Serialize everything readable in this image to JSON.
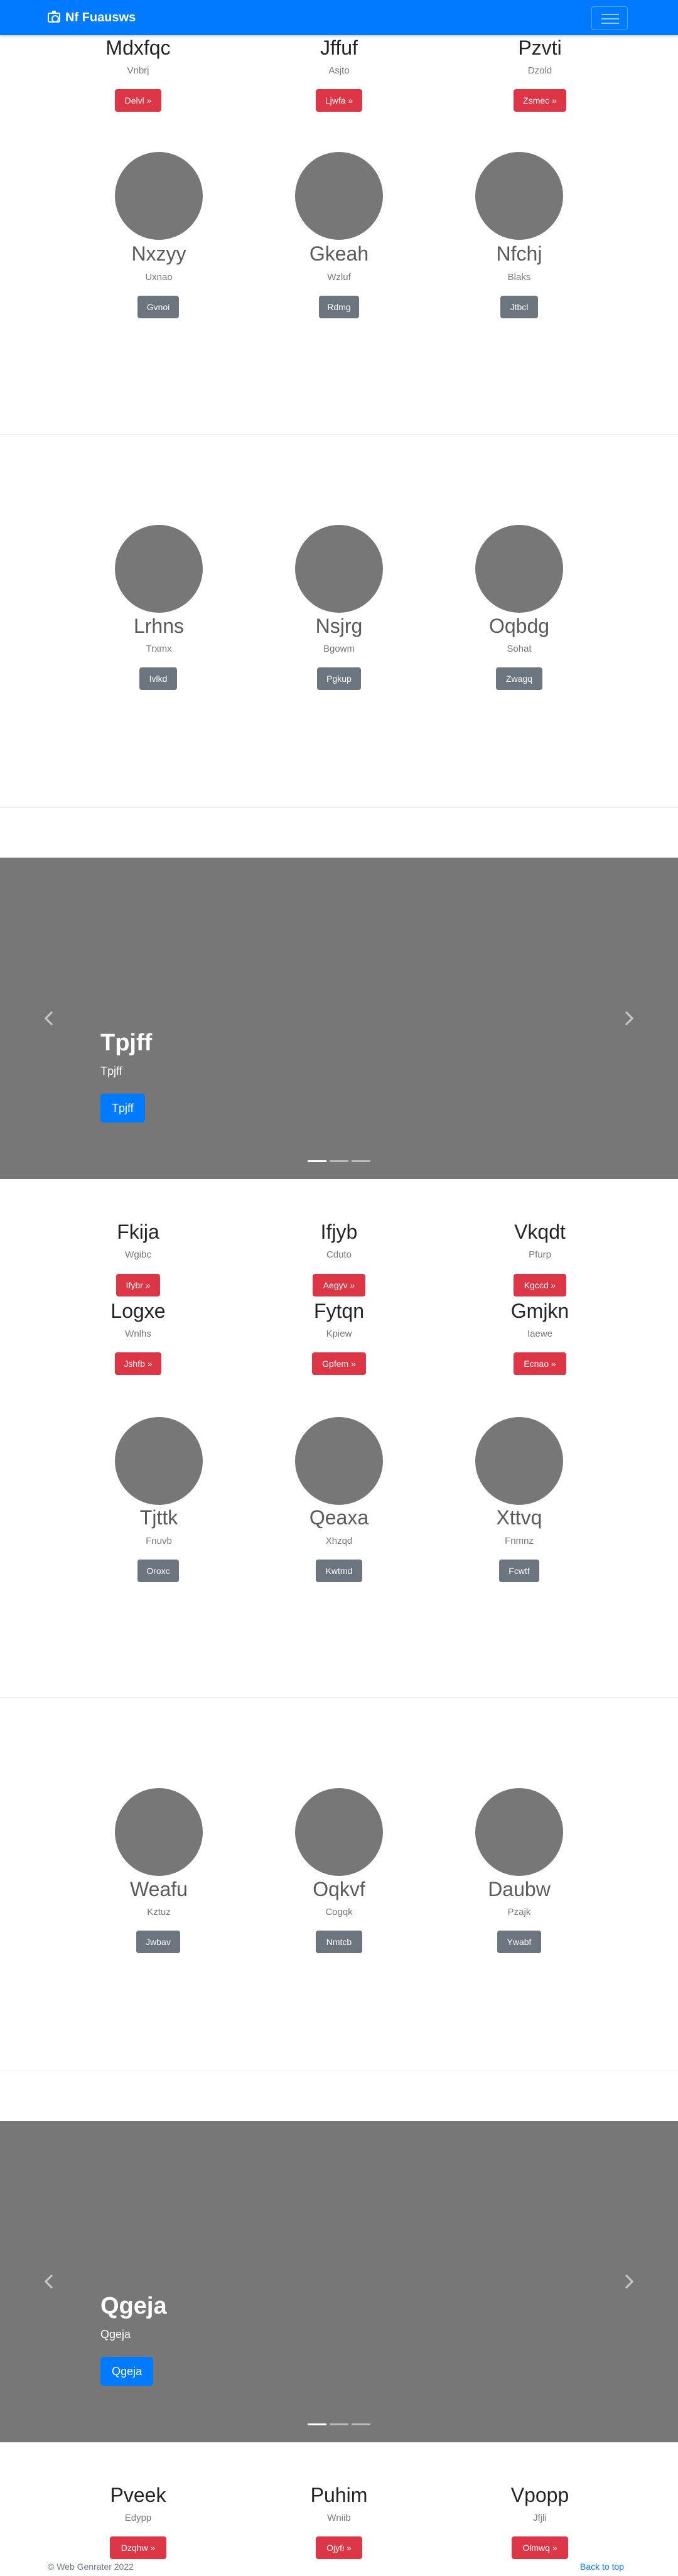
{
  "navbar": {
    "brand": "Nf Fuausws",
    "brand_icon": "camera-icon",
    "toggler_icon": "hamburger-icon"
  },
  "group1": {
    "cards": [
      {
        "name": "Mdxfqc",
        "sub": "Vnbrj",
        "button": "Delvl »"
      },
      {
        "name": "Jffuf",
        "sub": "Asjto",
        "button": "Ljwfa »"
      },
      {
        "name": "Pzvti",
        "sub": "Dzold",
        "button": "Zsmec »"
      }
    ],
    "avatars": [
      {
        "name": "Nxzyy",
        "sub": "Uxnao",
        "button": "Gvnoi"
      },
      {
        "name": "Gkeah",
        "sub": "Wzluf",
        "button": "Rdmg"
      },
      {
        "name": "Nfchj",
        "sub": "Blaks",
        "button": "Jtbcl"
      }
    ]
  },
  "group2": {
    "avatars": [
      {
        "name": "Lrhns",
        "sub": "Trxmx",
        "button": "Ivlkd"
      },
      {
        "name": "Nsjrg",
        "sub": "Bgowm",
        "button": "Pgkup"
      },
      {
        "name": "Oqbdg",
        "sub": "Sohat",
        "button": "Zwagq"
      }
    ]
  },
  "carousel1": {
    "title": "Tpjff",
    "subtitle": "Tpjff",
    "button": "Tpjff"
  },
  "group3": {
    "cards": [
      {
        "name": "Fkija",
        "sub": "Wgibc",
        "button": "Ifybr »"
      },
      {
        "name": "Ifjyb",
        "sub": "Cduto",
        "button": "Aegyv »"
      },
      {
        "name": "Vkqdt",
        "sub": "Pfurp",
        "button": "Kgccd »"
      },
      {
        "name": "Logxe",
        "sub": "Wnlhs",
        "button": "Jshfb »"
      },
      {
        "name": "Fytqn",
        "sub": "Kpiew",
        "button": "Gpfem »"
      },
      {
        "name": "Gmjkn",
        "sub": "Iaewe",
        "button": "Ecnao »"
      }
    ],
    "avatars": [
      {
        "name": "Tjttk",
        "sub": "Fnuvb",
        "button": "Oroxc"
      },
      {
        "name": "Qeaxa",
        "sub": "Xhzqd",
        "button": "Kwtmd"
      },
      {
        "name": "Xttvq",
        "sub": "Fnmnz",
        "button": "Fcwtf"
      }
    ]
  },
  "group4": {
    "avatars": [
      {
        "name": "Weafu",
        "sub": "Kztuz",
        "button": "Jwbav"
      },
      {
        "name": "Oqkvf",
        "sub": "Cogqk",
        "button": "Nmtcb"
      },
      {
        "name": "Daubw",
        "sub": "Pzajk",
        "button": "Ywabf"
      }
    ]
  },
  "carousel2": {
    "title": "Qgeja",
    "subtitle": "Qgeja",
    "button": "Qgeja"
  },
  "group5": {
    "cards": [
      {
        "name": "Pveek",
        "sub": "Edypp",
        "button": "Dzqhw »"
      },
      {
        "name": "Puhim",
        "sub": "Wniib",
        "button": "Ojyfi »"
      },
      {
        "name": "Vpopp",
        "sub": "Jfjli",
        "button": "Olmwq »"
      }
    ]
  },
  "footer": {
    "copyright": "© Web Genrater 2022",
    "back_to_top": "Back to top"
  },
  "colors": {
    "primary": "#007bff",
    "danger": "#dc3545",
    "secondary": "#6c757d",
    "placeholder": "#777777"
  }
}
